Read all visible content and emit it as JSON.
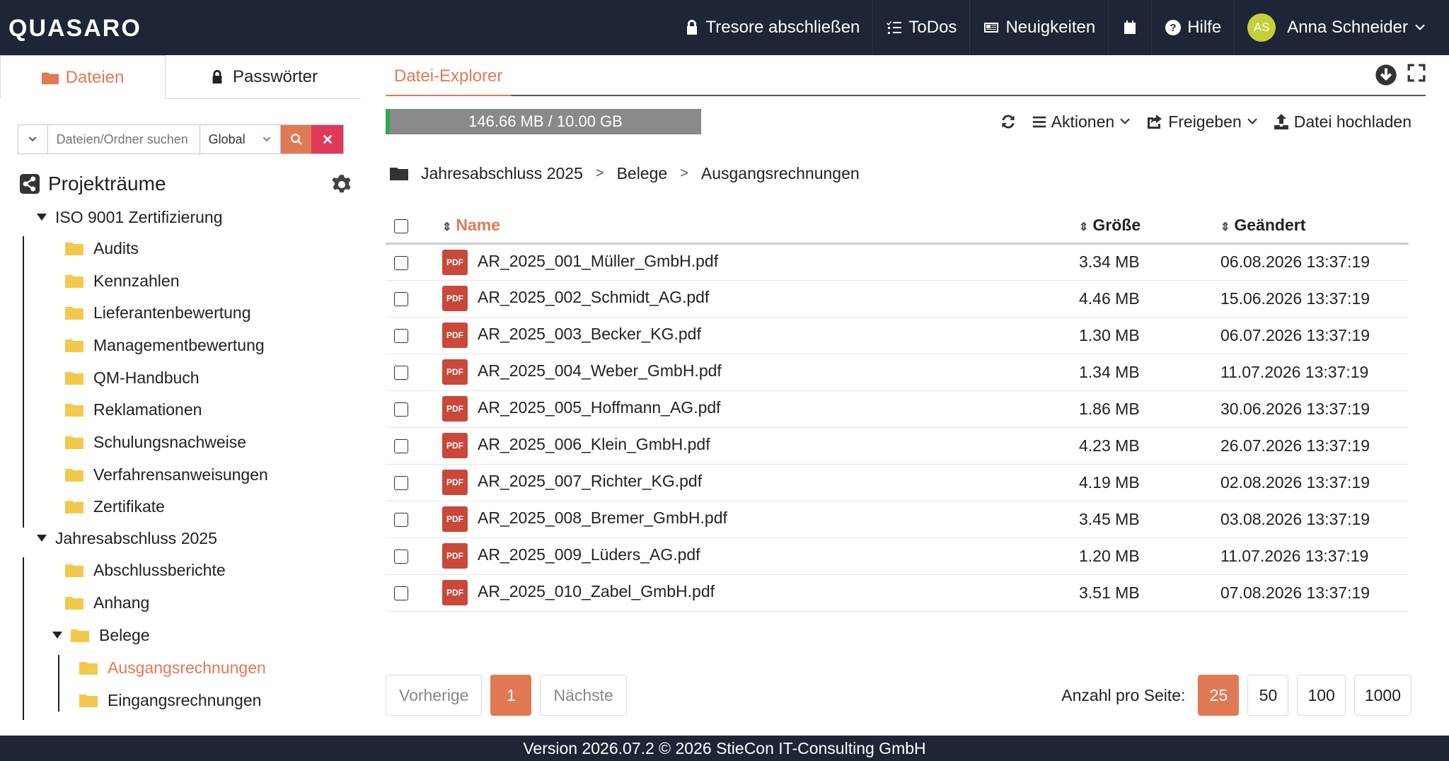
{
  "app": {
    "logo": "QUASARO"
  },
  "nav": {
    "lock_label": "Tresore abschließen",
    "todos_label": "ToDos",
    "news_label": "Neuigkeiten",
    "help_label": "Hilfe",
    "user_initials": "AS",
    "user_name": "Anna Schneider"
  },
  "sidebar": {
    "tabs": {
      "files": "Dateien",
      "passwords": "Passwörter"
    },
    "search": {
      "placeholder": "Dateien/Ordner suchen",
      "scope": "Global"
    },
    "projects_title": "Projekträume",
    "tree": [
      {
        "label": "ISO 9001 Zertifizierung",
        "type": "root"
      },
      {
        "label": "Audits"
      },
      {
        "label": "Kennzahlen"
      },
      {
        "label": "Lieferantenbewertung"
      },
      {
        "label": "Managementbewertung"
      },
      {
        "label": "QM-Handbuch"
      },
      {
        "label": "Reklamationen"
      },
      {
        "label": "Schulungsnachweise"
      },
      {
        "label": "Verfahrensanweisungen"
      },
      {
        "label": "Zertifikate"
      },
      {
        "label": "Jahresabschluss 2025",
        "type": "root"
      },
      {
        "label": "Abschlussberichte"
      },
      {
        "label": "Anhang"
      },
      {
        "label": "Belege",
        "expanded": true
      },
      {
        "label": "Ausgangsrechnungen",
        "selected": true
      },
      {
        "label": "Eingangsrechnungen"
      }
    ]
  },
  "main": {
    "tab_label": "Datei-Explorer",
    "quota": "146.66 MB / 10.00 GB",
    "actions": {
      "actions_label": "Aktionen",
      "share_label": "Freigeben",
      "upload_label": "Datei hochladen"
    },
    "breadcrumb": [
      "Jahresabschluss 2025",
      "Belege",
      "Ausgangsrechnungen"
    ],
    "breadcrumb_sep": ">",
    "columns": {
      "name": "Name",
      "size": "Größe",
      "modified": "Geändert"
    },
    "files": [
      {
        "name": "AR_2025_001_Müller_GmbH.pdf",
        "size": "3.34 MB",
        "modified": "06.08.2026 13:37:19"
      },
      {
        "name": "AR_2025_002_Schmidt_AG.pdf",
        "size": "4.46 MB",
        "modified": "15.06.2026 13:37:19"
      },
      {
        "name": "AR_2025_003_Becker_KG.pdf",
        "size": "1.30 MB",
        "modified": "06.07.2026 13:37:19"
      },
      {
        "name": "AR_2025_004_Weber_GmbH.pdf",
        "size": "1.34 MB",
        "modified": "11.07.2026 13:37:19"
      },
      {
        "name": "AR_2025_005_Hoffmann_AG.pdf",
        "size": "1.86 MB",
        "modified": "30.06.2026 13:37:19"
      },
      {
        "name": "AR_2025_006_Klein_GmbH.pdf",
        "size": "4.23 MB",
        "modified": "26.07.2026 13:37:19"
      },
      {
        "name": "AR_2025_007_Richter_KG.pdf",
        "size": "4.19 MB",
        "modified": "02.08.2026 13:37:19"
      },
      {
        "name": "AR_2025_008_Bremer_GmbH.pdf",
        "size": "3.45 MB",
        "modified": "03.08.2026 13:37:19"
      },
      {
        "name": "AR_2025_009_Lüders_AG.pdf",
        "size": "1.20 MB",
        "modified": "11.07.2026 13:37:19"
      },
      {
        "name": "AR_2025_010_Zabel_GmbH.pdf",
        "size": "3.51 MB",
        "modified": "07.08.2026 13:37:19"
      }
    ],
    "file_icon_text": "PDF",
    "pager": {
      "prev": "Vorherige",
      "page": "1",
      "next": "Nächste"
    },
    "per_page": {
      "label": "Anzahl pro Seite:",
      "options": [
        "25",
        "50",
        "100",
        "1000"
      ],
      "selected": "25"
    }
  },
  "footer": {
    "text": "Version 2026.07.2 © 2026 StieCon IT-Consulting GmbH"
  },
  "colors": {
    "navbar": "#1e2536",
    "accent": "#e07a55",
    "folder": "#f2c94c",
    "pdf": "#c9483a",
    "danger": "#e0395a"
  }
}
